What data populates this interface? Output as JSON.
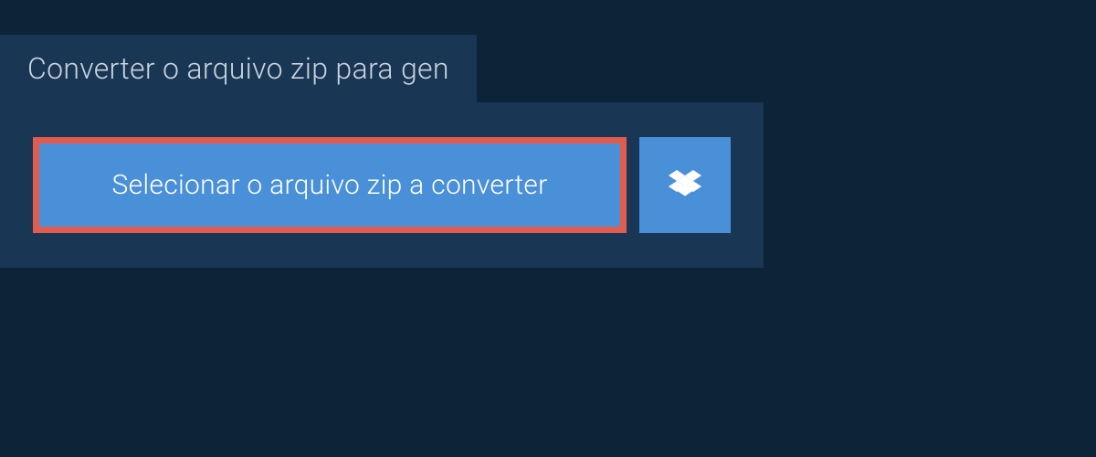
{
  "header": {
    "tab_label": "Converter o arquivo zip para gen"
  },
  "actions": {
    "select_file_label": "Selecionar o arquivo zip a converter",
    "dropbox_icon_name": "dropbox-icon"
  },
  "colors": {
    "background": "#0d2438",
    "panel": "#193654",
    "button": "#4a90d9",
    "highlight_border": "#e25c4e",
    "text_light": "#c8d4dd",
    "text_white": "#ffffff"
  }
}
